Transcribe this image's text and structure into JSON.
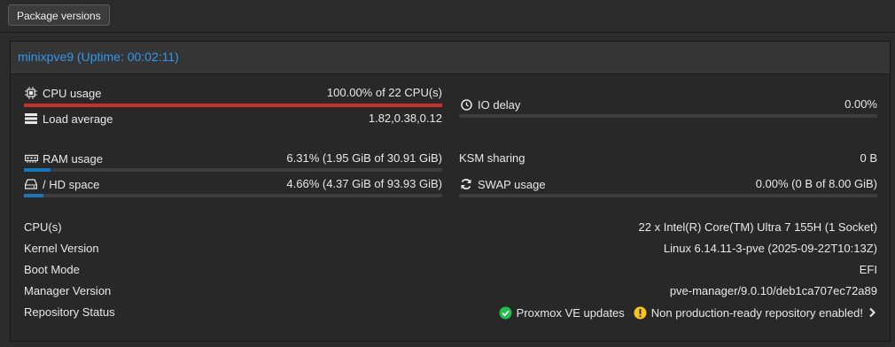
{
  "toolbar": {
    "package_versions_label": "Package versions"
  },
  "panel": {
    "title": "minixpve9 (Uptime: 00:02:11)"
  },
  "stats": {
    "cpu": {
      "label": "CPU usage",
      "value": "100.00% of 22 CPU(s)",
      "fraction": 1.0,
      "color": "#c9302c"
    },
    "load": {
      "label": "Load average",
      "value": "1.82,0.38,0.12"
    },
    "io": {
      "label": "IO delay",
      "value": "0.00%",
      "fraction": 0.0
    },
    "ram": {
      "label": "RAM usage",
      "value": "6.31% (1.95 GiB of 30.91 GiB)",
      "fraction": 0.0631,
      "color": "#1b75bb"
    },
    "ksm": {
      "label": "KSM sharing",
      "value": "0 B"
    },
    "hd": {
      "label": "/ HD space",
      "value": "4.66% (4.37 GiB of 93.93 GiB)",
      "fraction": 0.0466,
      "color": "#1b75bb"
    },
    "swap": {
      "label": "SWAP usage",
      "value": "0.00% (0 B of 8.00 GiB)",
      "fraction": 0.0
    }
  },
  "info": {
    "cpus": {
      "label": "CPU(s)",
      "value": "22 x Intel(R) Core(TM) Ultra 7 155H (1 Socket)"
    },
    "kernel": {
      "label": "Kernel Version",
      "value": "Linux 6.14.11-3-pve (2025-09-22T10:13Z)"
    },
    "boot": {
      "label": "Boot Mode",
      "value": "EFI"
    },
    "manager": {
      "label": "Manager Version",
      "value": "pve-manager/9.0.10/deb1ca707ec72a89"
    },
    "repo": {
      "label": "Repository Status",
      "ok_text": "Proxmox VE updates",
      "warn_text": "Non production-ready repository enabled!",
      "ok_color": "#21bf4b",
      "warn_color": "#f5c518"
    }
  },
  "icons": {
    "cpu": "cpu-chip-icon",
    "load": "server-stack-icon",
    "io": "clock-icon",
    "ram": "memory-icon",
    "hd": "hard-drive-icon",
    "swap": "refresh-icon",
    "ok": "check-circle-icon",
    "warn": "exclamation-circle-icon",
    "expand": "chevron-right-icon"
  }
}
